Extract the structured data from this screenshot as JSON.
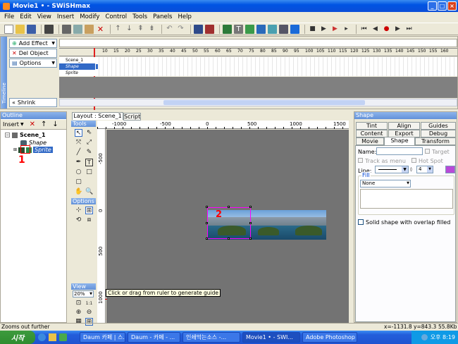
{
  "window": {
    "title": "Movie1 • - SWiSHmax",
    "min": "_",
    "max": "□",
    "close": "×"
  },
  "menu": [
    "File",
    "Edit",
    "View",
    "Insert",
    "Modify",
    "Control",
    "Tools",
    "Panels",
    "Help"
  ],
  "timeline": {
    "add_effect": "Add Effect",
    "del_object": "Del Object",
    "options": "Options",
    "shrink": "Shrink",
    "side_label": "Timeline",
    "frame_ticks": [
      "10",
      "15",
      "20",
      "25",
      "30",
      "35",
      "40",
      "45",
      "50",
      "55",
      "60",
      "65",
      "70",
      "75",
      "80",
      "85",
      "90",
      "95",
      "100",
      "105",
      "110",
      "115",
      "120",
      "125",
      "130",
      "135",
      "140",
      "145",
      "150",
      "155",
      "160"
    ],
    "tracks": [
      "Scene_1",
      "Shape",
      "Sprite"
    ]
  },
  "outline": {
    "title": "Outline",
    "insert_label": "Insert",
    "scene": "Scene_1",
    "items": [
      "Shape",
      "Sprite"
    ],
    "annotation": "1"
  },
  "layout": {
    "tabs": [
      "Layout : Scene_1",
      "Script"
    ],
    "tools_title": "Tools",
    "options_title": "Options",
    "view_title": "View",
    "zoom": "20%",
    "h_ruler": [
      "-1000",
      "-500",
      "0",
      "500",
      "1000",
      "1500"
    ],
    "v_ruler": [
      "-500",
      "0",
      "500",
      "1000"
    ],
    "tooltip": "Click or drag from ruler to generate guide",
    "annotation": "2"
  },
  "shape_panel": {
    "title": "Shape",
    "tabs_row1": [
      "Tint",
      "Align",
      "Guides"
    ],
    "tabs_row2": [
      "Content",
      "Export",
      "Debug"
    ],
    "tabs_row3": [
      "Movie",
      "Shape",
      "Transform"
    ],
    "name_label": "Name:",
    "target_label": "Target",
    "track_as_menu": "Track as menu",
    "hot_spot": "Hot Spot",
    "line_label": "Line:",
    "line_width": "4",
    "fill_label": "Fill",
    "fill_value": "None",
    "solid_shape": "Solid shape with overlap filled"
  },
  "status": {
    "left": "Zooms out further",
    "coords": "x=-1131.8 y=843.3",
    "size": "55.8Kb"
  },
  "taskbar": {
    "start": "시작",
    "tasks": [
      "Daum 카페 | 스...",
      "Daum - 카페 - ...",
      "인쇄막는소스 -...",
      "Movie1 • - SWI...",
      "Adobe Photoshop"
    ],
    "clock": "오후 8:19"
  },
  "colors": {
    "accent": "#0054e3",
    "selection": "#ff00ff",
    "annotation": "#ff0000"
  }
}
